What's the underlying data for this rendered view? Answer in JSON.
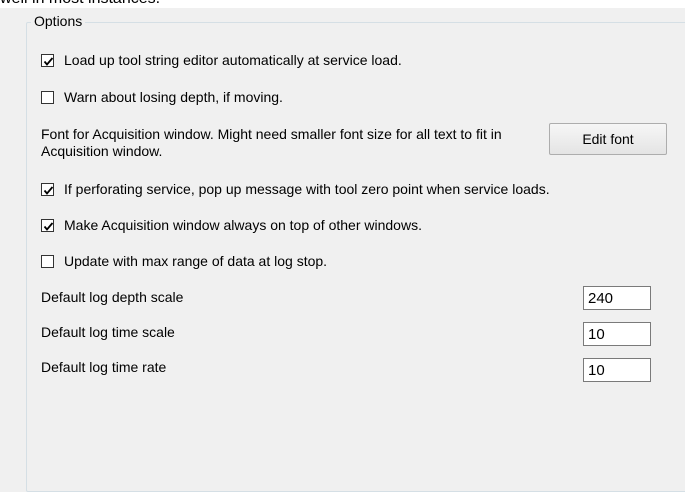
{
  "window": {
    "top_cut_text": "well in most instances."
  },
  "options": {
    "title": "Options",
    "checkboxes": [
      {
        "label": "Load up tool string editor automatically at service load.",
        "checked": true
      },
      {
        "label": "Warn about losing depth, if moving.",
        "checked": false
      },
      {
        "label": "If perforating service, pop up message with tool zero point when service loads.",
        "checked": true
      },
      {
        "label": "Make Acquisition window always on top of other windows.",
        "checked": true
      },
      {
        "label": "Update with max range of data at log stop.",
        "checked": false
      }
    ],
    "font_note": "Font for Acquisition window.  Might need smaller font size for all text to fit in Acquisition window.",
    "edit_font_label": "Edit font",
    "fields": [
      {
        "label": "Default log depth scale",
        "value": "240"
      },
      {
        "label": "Default log time scale",
        "value": "10"
      },
      {
        "label": "Default log time rate",
        "value": "10"
      }
    ]
  }
}
